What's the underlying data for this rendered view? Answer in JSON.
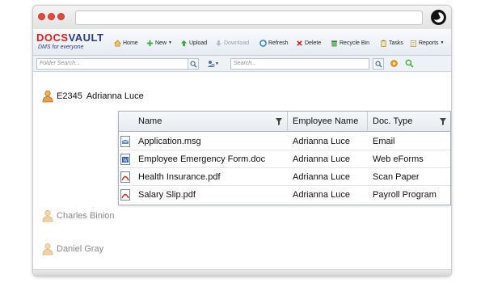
{
  "toolbar": {
    "logo_docs": "DOCS",
    "logo_vault": "VAULT",
    "logo_tagline": "DMS for everyone",
    "home": "Home",
    "new": "New",
    "upload": "Upload",
    "download": "Download",
    "refresh": "Refresh",
    "delete": "Delete",
    "recycle_bin": "Recycle Bin",
    "tasks": "Tasks",
    "reports": "Reports"
  },
  "search": {
    "folder_placeholder": "Folder Search...",
    "global_placeholder": "Search..."
  },
  "tree": {
    "selected": {
      "code": "E2345",
      "name": "Adrianna Luce"
    },
    "others": [
      "Charles Binion",
      "Daniel Gray"
    ]
  },
  "grid": {
    "columns": [
      "Name",
      "Employee Name",
      "Doc. Type"
    ],
    "rows": [
      {
        "icon": "email-file-icon",
        "name": "Application.msg",
        "employee": "Adrianna Luce",
        "type": "Email"
      },
      {
        "icon": "word-file-icon",
        "name": "Employee Emergency Form.doc",
        "employee": "Adrianna Luce",
        "type": "Web eForms"
      },
      {
        "icon": "pdf-file-icon",
        "name": "Health Insurance.pdf",
        "employee": "Adrianna Luce",
        "type": "Scan Paper"
      },
      {
        "icon": "pdf-file-icon",
        "name": "Salary Slip.pdf",
        "employee": "Adrianna Luce",
        "type": "Payroll Program"
      }
    ]
  },
  "colors": {
    "brand_blue": "#2a3a8c",
    "brand_red": "#d9231b",
    "window_dot": "#e04b3b"
  }
}
